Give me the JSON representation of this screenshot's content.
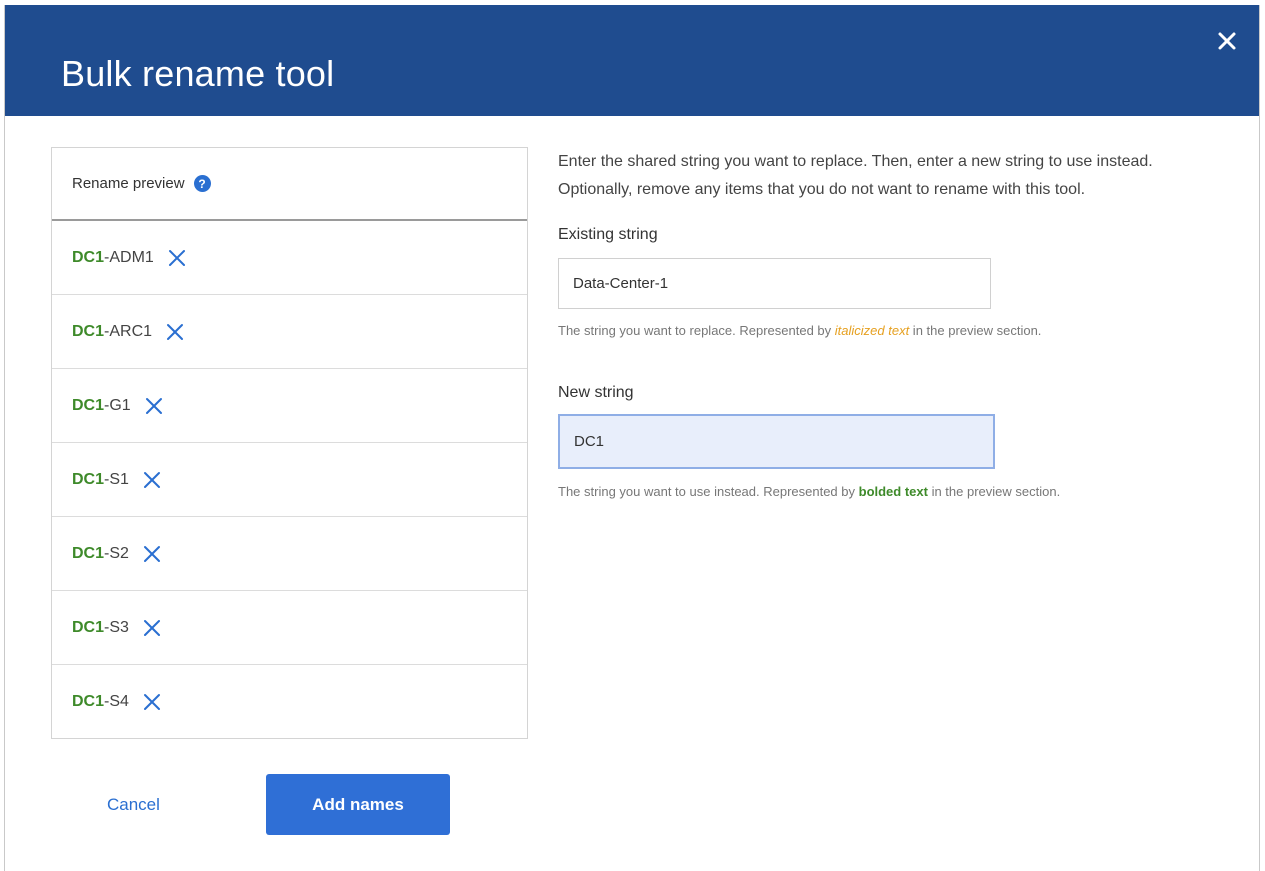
{
  "dialog": {
    "title": "Bulk rename tool"
  },
  "preview": {
    "header": "Rename preview",
    "help_glyph": "?",
    "items": [
      {
        "prefix": "DC1",
        "suffix": "-ADM1"
      },
      {
        "prefix": "DC1",
        "suffix": "-ARC1"
      },
      {
        "prefix": "DC1",
        "suffix": "-G1"
      },
      {
        "prefix": "DC1",
        "suffix": "-S1"
      },
      {
        "prefix": "DC1",
        "suffix": "-S2"
      },
      {
        "prefix": "DC1",
        "suffix": "-S3"
      },
      {
        "prefix": "DC1",
        "suffix": "-S4"
      }
    ]
  },
  "form": {
    "instructions": "Enter the shared string you want to replace. Then, enter a new string to use instead. Optionally, remove any items that you do not want to rename with this tool.",
    "existing": {
      "label": "Existing string",
      "value": "Data-Center-1",
      "hint_before": "The string you want to replace. Represented by ",
      "hint_emph": "italicized text",
      "hint_after": " in the preview section."
    },
    "new": {
      "label": "New string",
      "value": "DC1",
      "hint_before": "The string you want to use instead. Represented by ",
      "hint_emph": "bolded text",
      "hint_after": " in the preview section."
    }
  },
  "actions": {
    "cancel": "Cancel",
    "submit": "Add names"
  },
  "colors": {
    "header_bg": "#1f4c8f",
    "primary": "#2f6fd6",
    "link": "#2a6fd1",
    "new_text": "#3e8a2a",
    "existing_text": "#e6a020"
  }
}
